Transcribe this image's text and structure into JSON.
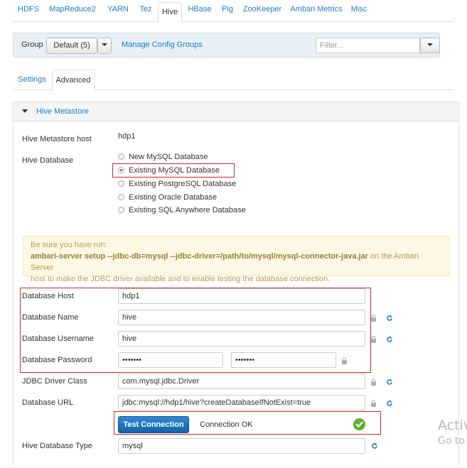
{
  "service_tabs": [
    "HDFS",
    "MapReduce2",
    "YARN",
    "Tez",
    "Hive",
    "HBase",
    "Pig",
    "ZooKeeper",
    "Ambari Metrics",
    "Misc"
  ],
  "active_service": "Hive",
  "group_bar": {
    "group_label": "Group",
    "group_value": "Default (5)",
    "manage_link": "Manage Config Groups",
    "filter_placeholder": "Filter..."
  },
  "sub_tabs": [
    "Settings",
    "Advanced"
  ],
  "active_sub_tab": "Advanced",
  "panel": {
    "title": "Hive Metastore",
    "metastore_host_label": "Hive Metastore host",
    "metastore_host_value": "hdp1",
    "hive_database_label": "Hive Database",
    "db_options": [
      "New MySQL Database",
      "Existing MySQL Database",
      "Existing PostgreSQL Database",
      "Existing Oracle Database",
      "Existing SQL Anywhere Database"
    ],
    "selected_db_option": "Existing MySQL Database",
    "alert": {
      "line1": "Be sure you have run:",
      "command": "ambari-server setup --jdbc-db=mysql --jdbc-driver=/path/to/mysql/mysql-connector-java.jar",
      "line2_suffix": " on the Ambari Server",
      "line3": "host to make the JDBC driver available and to enable testing the database connection."
    },
    "fields": {
      "db_host_label": "Database Host",
      "db_host_value": "hdp1",
      "db_name_label": "Database Name",
      "db_name_value": "hive",
      "db_username_label": "Database Username",
      "db_username_value": "hive",
      "db_password_label": "Database Password",
      "db_password_value": "•••••••",
      "db_password_confirm": "•••••••",
      "jdbc_driver_label": "JDBC Driver Class",
      "jdbc_driver_value": "com.mysql.jdbc.Driver",
      "db_url_label": "Database URL",
      "db_url_value": "jdbc:mysql://hdp1/hive?createDatabaseIfNotExist=true",
      "db_type_label": "Hive Database Type",
      "db_type_value": "mysql"
    },
    "test_button": "Test Connection",
    "connection_status": "Connection OK"
  },
  "watermark": {
    "line1": "Activ",
    "line2": "Go to"
  },
  "colors": {
    "link": "#1a7fc1",
    "highlight_border": "#d0282e",
    "ok_green": "#5cb130",
    "primary_button": "#1562a8"
  }
}
